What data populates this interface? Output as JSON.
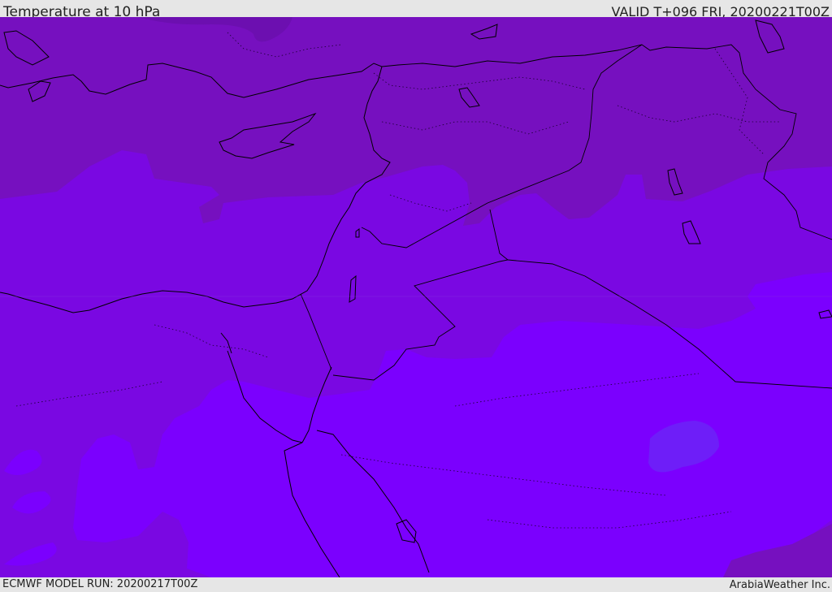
{
  "header": {
    "title": "Temperature at 10 hPa",
    "valid": "VALID T+096 FRI, 20200221T00Z"
  },
  "footer": {
    "model_run": "ECMWF MODEL RUN: 20200217T00Z",
    "credit": "ArabiaWeather Inc."
  },
  "colors": {
    "shade_dark": "#6c0fb0",
    "shade_mid_dark": "#7610bf",
    "shade_mid": "#7a08e2",
    "shade_light": "#7b00fe",
    "shade_blue": "#6e1ef8",
    "coastline": "#000000",
    "bar": "#e6e6e6"
  }
}
